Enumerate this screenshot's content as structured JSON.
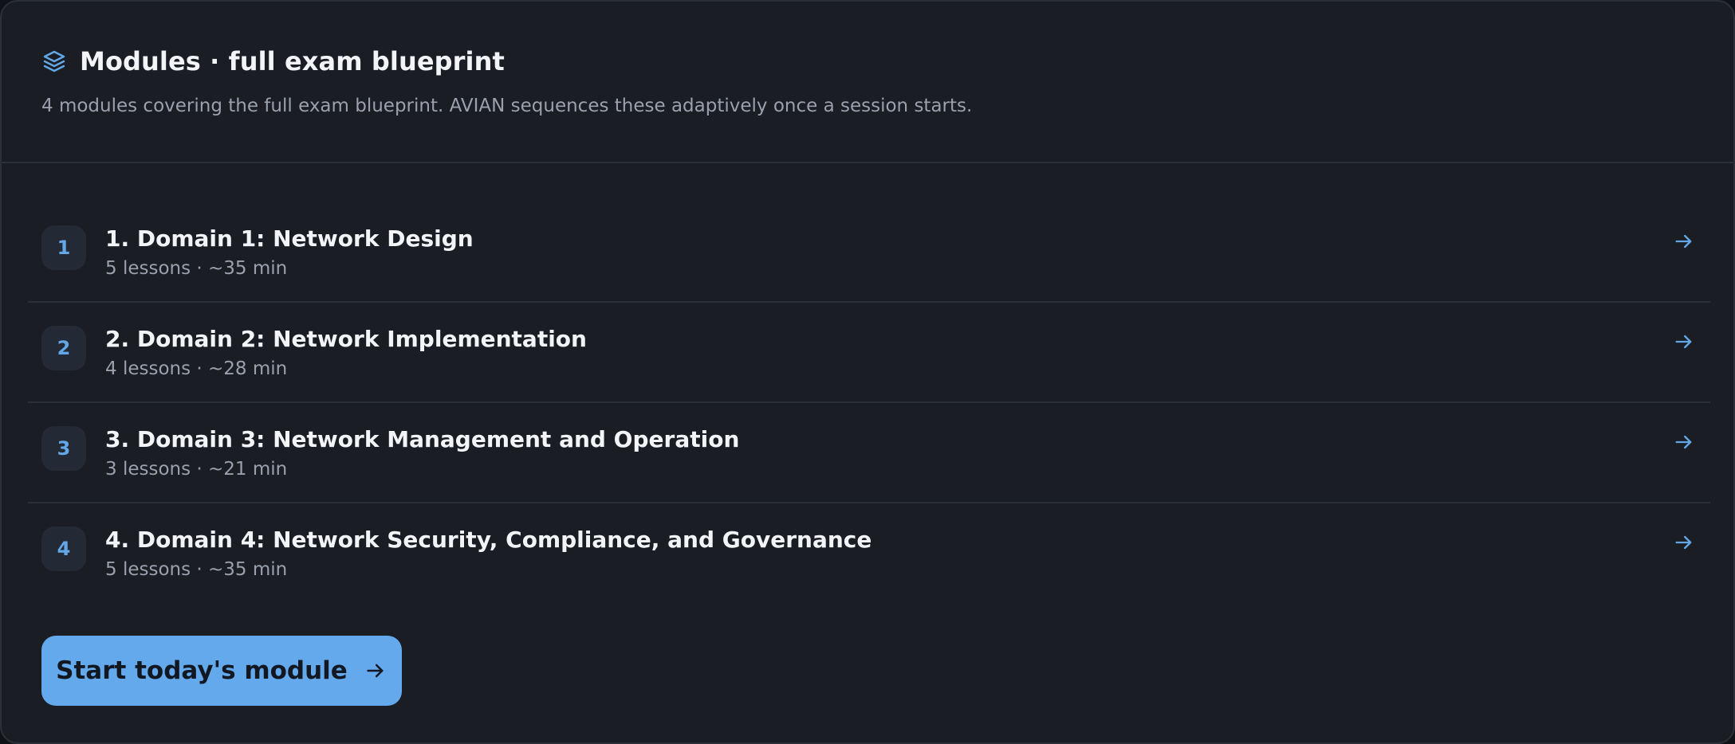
{
  "header": {
    "icon": "layers-icon",
    "title": "Modules · full exam blueprint",
    "subtitle": "4 modules covering the full exam blueprint. AVIAN sequences these adaptively once a session starts."
  },
  "modules": [
    {
      "number": "1",
      "title": "1. Domain 1: Network Design",
      "meta": "5 lessons · ~35 min",
      "icon": "arrow-right-icon"
    },
    {
      "number": "2",
      "title": "2. Domain 2: Network Implementation",
      "meta": "4 lessons · ~28 min",
      "icon": "arrow-right-icon"
    },
    {
      "number": "3",
      "title": "3. Domain 3: Network Management and Operation",
      "meta": "3 lessons · ~21 min",
      "icon": "arrow-right-icon"
    },
    {
      "number": "4",
      "title": "4. Domain 4: Network Security, Compliance, and Governance",
      "meta": "5 lessons · ~35 min",
      "icon": "arrow-right-icon"
    }
  ],
  "actions": {
    "start_label": "Start today's module",
    "start_icon": "arrow-right-icon"
  },
  "colors": {
    "background": "#1a1d24",
    "border": "#2b2f38",
    "accent": "#64a9eb",
    "badge_bg": "#232a35",
    "text_primary": "#f2f4f7",
    "text_secondary": "#9aa1ad"
  }
}
